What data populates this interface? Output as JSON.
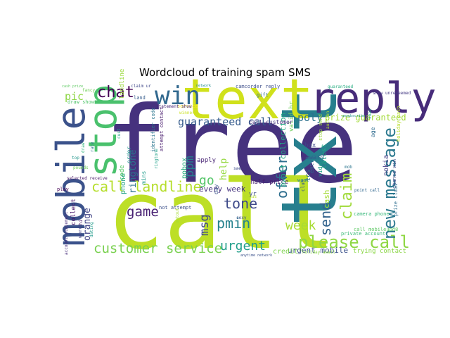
{
  "chart_data": {
    "type": "wordcloud",
    "title": "Wordcloud of training spam SMS",
    "background": "#ffffff",
    "colormap": "viridis",
    "words": [
      {
        "text": "free",
        "weight": 1.0,
        "color": "#46327e"
      },
      {
        "text": "call",
        "weight": 0.98,
        "color": "#bddf26"
      },
      {
        "text": "txt",
        "weight": 0.7,
        "color": "#277f8e"
      },
      {
        "text": "text",
        "weight": 0.55,
        "color": "#d0e11c"
      },
      {
        "text": "reply",
        "weight": 0.45,
        "color": "#472c7a"
      },
      {
        "text": "mobile",
        "weight": 0.45,
        "color": "#3b528b"
      },
      {
        "text": "stop",
        "weight": 0.42,
        "color": "#4ac16d"
      },
      {
        "text": "win",
        "weight": 0.3,
        "color": "#31688e"
      },
      {
        "text": "please call",
        "weight": 0.25,
        "color": "#8fd744"
      },
      {
        "text": "new message",
        "weight": 0.22,
        "color": "#2a788e"
      },
      {
        "text": "chat",
        "weight": 0.18,
        "color": "#440154"
      },
      {
        "text": "call landline",
        "weight": 0.17,
        "color": "#b5de2b"
      },
      {
        "text": "customer service",
        "weight": 0.16,
        "color": "#7ad151"
      },
      {
        "text": "game",
        "weight": 0.16,
        "color": "#482173"
      },
      {
        "text": "pmin",
        "weight": 0.15,
        "color": "#26828e"
      },
      {
        "text": "tone",
        "weight": 0.15,
        "color": "#3e4a89"
      },
      {
        "text": "urgent",
        "weight": 0.15,
        "color": "#1f9e89"
      },
      {
        "text": "claim",
        "weight": 0.15,
        "color": "#a0da39"
      },
      {
        "text": "send",
        "weight": 0.14,
        "color": "#33638d"
      },
      {
        "text": "offer",
        "weight": 0.14,
        "color": "#2e6e8e"
      },
      {
        "text": "week",
        "weight": 0.13,
        "color": "#a8db34"
      },
      {
        "text": "go",
        "weight": 0.12,
        "color": "#54c568"
      },
      {
        "text": "guaranteed call",
        "weight": 0.11,
        "color": "#365c8d"
      },
      {
        "text": "pic",
        "weight": 0.11,
        "color": "#8ed645"
      },
      {
        "text": "msg",
        "weight": 0.11,
        "color": "#3f4788"
      },
      {
        "text": "ppm",
        "weight": 0.11,
        "color": "#287d8e"
      },
      {
        "text": "poly",
        "weight": 0.1,
        "color": "#2c718e"
      },
      {
        "text": "prize guaranteed",
        "weight": 0.09,
        "color": "#a2da37"
      },
      {
        "text": "ringtone",
        "weight": 0.09,
        "color": "#2d708e"
      },
      {
        "text": "orange",
        "weight": 0.08,
        "color": "#414487"
      },
      {
        "text": "help",
        "weight": 0.08,
        "color": "#95d840"
      },
      {
        "text": "every week",
        "weight": 0.07,
        "color": "#46337f"
      },
      {
        "text": "urgent mobile",
        "weight": 0.07,
        "color": "#3b518b"
      },
      {
        "text": "credit",
        "weight": 0.06,
        "color": "#7fd34e"
      },
      {
        "text": "half price",
        "weight": 0.06,
        "color": "#481f70"
      },
      {
        "text": "phone",
        "weight": 0.06,
        "color": "#1fa187"
      },
      {
        "text": "await collection",
        "weight": 0.06,
        "color": "#22a884"
      },
      {
        "text": "valid hr",
        "weight": 0.06,
        "color": "#6ccd5a"
      },
      {
        "text": "latest",
        "weight": 0.06,
        "color": "#22a785"
      },
      {
        "text": "yr",
        "weight": 0.06,
        "color": "#3d4d8a"
      },
      {
        "text": "cash",
        "weight": 0.05,
        "color": "#a5db36"
      },
      {
        "text": "pobox",
        "weight": 0.05,
        "color": "#29af7f"
      },
      {
        "text": "award",
        "weight": 0.05,
        "color": "#34618d"
      },
      {
        "text": "apply",
        "weight": 0.05,
        "color": "#482475"
      },
      {
        "text": "box",
        "weight": 0.05,
        "color": "#3f4889"
      },
      {
        "text": "nokia",
        "weight": 0.05,
        "color": "#433e85"
      },
      {
        "text": "trying contact",
        "weight": 0.05,
        "color": "#8bd646"
      },
      {
        "text": "call customer",
        "weight": 0.05,
        "color": "#45337d"
      },
      {
        "text": "service",
        "weight": 0.05,
        "color": "#fde725"
      },
      {
        "text": "statement show",
        "weight": 0.05,
        "color": "#482576"
      },
      {
        "text": "private account",
        "weight": 0.05,
        "color": "#3aba76"
      },
      {
        "text": "tcs",
        "weight": 0.05,
        "color": "#2f6c8e"
      },
      {
        "text": "camera phone",
        "weight": 0.05,
        "color": "#35b779"
      },
      {
        "text": "collect",
        "weight": 0.05,
        "color": "#481467"
      },
      {
        "text": "gift",
        "weight": 0.05,
        "color": "#2e6f8e"
      },
      {
        "text": "order",
        "weight": 0.04,
        "color": "#20928c"
      },
      {
        "text": "code",
        "weight": 0.04,
        "color": "#56c667"
      },
      {
        "text": "landline",
        "weight": 0.04,
        "color": "#9bd93c"
      },
      {
        "text": "mins",
        "weight": 0.04,
        "color": "#1e9b8a"
      },
      {
        "text": "entry",
        "weight": 0.04,
        "color": "#31678e"
      },
      {
        "text": "camcorder reply",
        "weight": 0.04,
        "color": "#3d4e8a"
      },
      {
        "text": "holiday cash",
        "weight": 0.04,
        "color": "#b8de29"
      },
      {
        "text": "identifier code",
        "weight": 0.04,
        "color": "#2a768e"
      },
      {
        "text": "attempt contact",
        "weight": 0.04,
        "color": "#481b6d"
      },
      {
        "text": "guaranteed",
        "weight": 0.04,
        "color": "#27ad81"
      },
      {
        "text": "video",
        "weight": 0.04,
        "color": "#1e9c89"
      },
      {
        "text": "account statement",
        "weight": 0.04,
        "color": "#472d7b"
      },
      {
        "text": "draw shows",
        "weight": 0.04,
        "color": "#4fc46a"
      },
      {
        "text": "want",
        "weight": 0.04,
        "color": "#25848e"
      },
      {
        "text": "chance win",
        "weight": 0.04,
        "color": "#3e4989"
      },
      {
        "text": "prize claim",
        "weight": 0.04,
        "color": "#2e6d8e"
      },
      {
        "text": "call mobileupd8",
        "weight": 0.04,
        "color": "#5cc863"
      },
      {
        "text": "dating",
        "weight": 0.04,
        "color": "#1f998a"
      },
      {
        "text": "club",
        "weight": 0.04,
        "color": "#39558c"
      },
      {
        "text": "age",
        "weight": 0.04,
        "color": "#2f6b8e"
      },
      {
        "text": "day",
        "weight": 0.04,
        "color": "#3b528b"
      },
      {
        "text": "stop send",
        "weight": 0.03,
        "color": "#9dd93b"
      },
      {
        "text": "hi",
        "weight": 0.03,
        "color": "#48186a"
      },
      {
        "text": "word",
        "weight": 0.03,
        "color": "#424186"
      },
      {
        "text": "land",
        "weight": 0.03,
        "color": "#365d8d"
      },
      {
        "text": "claim ur",
        "weight": 0.03,
        "color": "#3f4788"
      },
      {
        "text": "cust",
        "weight": 0.03,
        "color": "#20a386"
      },
      {
        "text": "play",
        "weight": 0.03,
        "color": "#440154"
      },
      {
        "text": "auction",
        "weight": 0.03,
        "color": "#b2dd2d"
      },
      {
        "text": "draw",
        "weight": 0.03,
        "color": "#31b57b"
      },
      {
        "text": "rate",
        "weight": 0.03,
        "color": "#2c728e"
      },
      {
        "text": "network",
        "weight": 0.03,
        "color": "#228d8d"
      },
      {
        "text": "selected receive",
        "weight": 0.03,
        "color": "#481668"
      },
      {
        "text": "not attempt",
        "weight": 0.03,
        "color": "#3c508b"
      },
      {
        "text": "cash prize",
        "weight": 0.03,
        "color": "#5ec962"
      },
      {
        "text": "top",
        "weight": 0.03,
        "color": "#1f958b"
      },
      {
        "text": "fancy",
        "weight": 0.03,
        "color": "#70cf57"
      },
      {
        "text": "unsubscribe",
        "weight": 0.03,
        "color": "#21918c"
      },
      {
        "text": "ringtone",
        "weight": 0.03,
        "color": "#1fa088"
      },
      {
        "text": "optout",
        "weight": 0.03,
        "color": "#a5db36"
      },
      {
        "text": "sexy",
        "weight": 0.03,
        "color": "#3a538b"
      },
      {
        "text": "bonus",
        "weight": 0.03,
        "color": "#b5de2b"
      },
      {
        "text": "winner",
        "weight": 0.03,
        "color": "#cae11f"
      },
      {
        "text": "pounds",
        "weight": 0.03,
        "color": "#6ece58"
      },
      {
        "text": "sae",
        "weight": 0.03,
        "color": "#3e4c8a"
      },
      {
        "text": "mob",
        "weight": 0.03,
        "color": "#2b758e"
      },
      {
        "text": "xmas",
        "weight": 0.03,
        "color": "#23a983"
      },
      {
        "text": "show unredeemed",
        "weight": 0.03,
        "color": "#443983"
      },
      {
        "text": "point call",
        "weight": 0.03,
        "color": "#31678e"
      },
      {
        "text": "holiday await",
        "weight": 0.03,
        "color": "#8bd646"
      },
      {
        "text": "anytime network",
        "weight": 0.03,
        "color": "#3b518b"
      }
    ]
  }
}
